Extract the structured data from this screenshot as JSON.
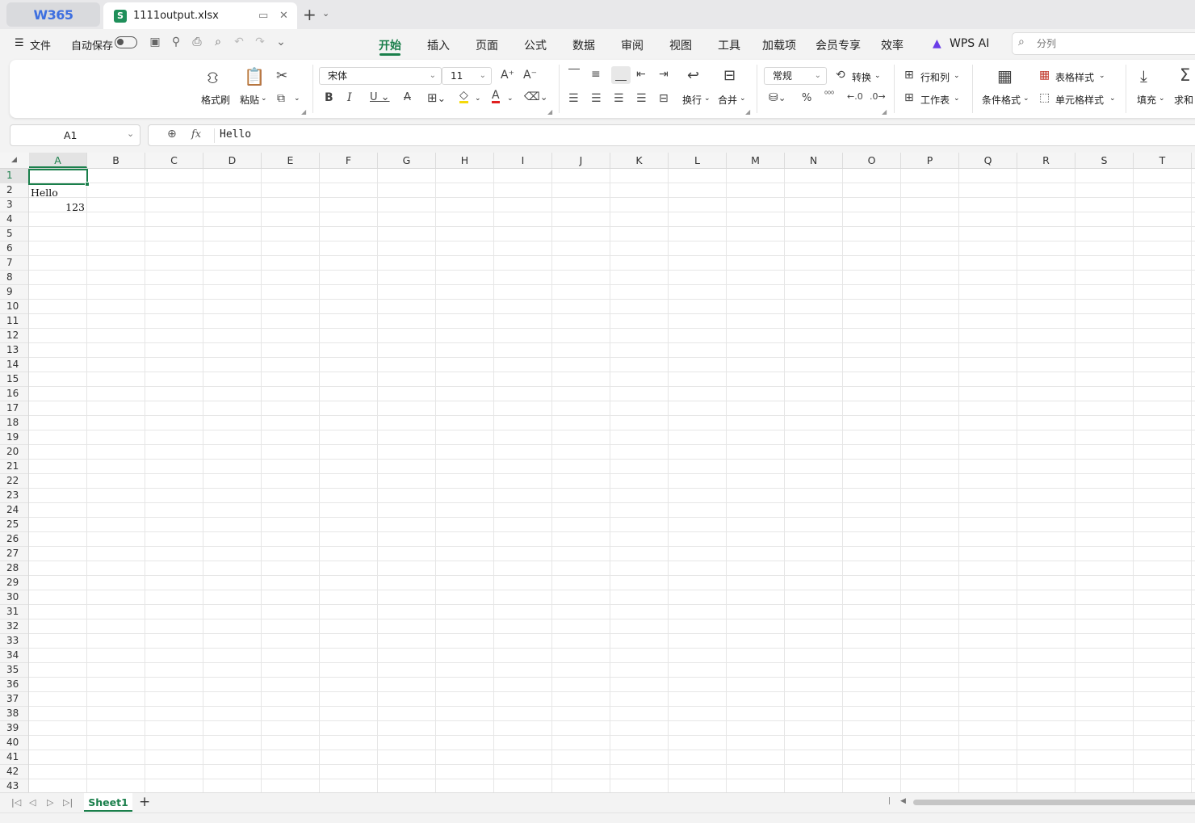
{
  "tabs": {
    "app_logo": "W365",
    "file_badge": "S",
    "file_title": "1111output.xlsx"
  },
  "menu": {
    "file_label": "文件",
    "autosave_label": "自动保存",
    "ribbon_tabs": [
      "开始",
      "插入",
      "页面",
      "公式",
      "数据",
      "审阅",
      "视图",
      "工具",
      "加载项",
      "会员专享",
      "效率"
    ],
    "active_tab": "开始",
    "wps_ai": "WPS AI",
    "search_placeholder": "分列"
  },
  "ribbon": {
    "format_painter": "格式刷",
    "paste": "粘贴",
    "font_name": "宋体",
    "font_size": "11",
    "wrap": "换行",
    "merge": "合并",
    "number_format": "常规",
    "convert": "转换",
    "rows_cols": "行和列",
    "worksheet": "工作表",
    "conditional_format": "条件格式",
    "table_style": "表格样式",
    "cell_style": "单元格样式",
    "fill": "填充",
    "sum": "求和"
  },
  "formula_bar": {
    "name_box": "A1",
    "fx_label": "fx",
    "content": "Hello"
  },
  "grid": {
    "columns": [
      "A",
      "B",
      "C",
      "D",
      "E",
      "F",
      "G",
      "H",
      "I",
      "J",
      "K",
      "L",
      "M",
      "N",
      "O",
      "P",
      "Q",
      "R",
      "S",
      "T"
    ],
    "selected_column": "A",
    "selected_row": 1,
    "row_count": 43,
    "cells": {
      "A1": "Hello",
      "A2": "123"
    }
  },
  "sheets": {
    "names": [
      "Sheet1"
    ],
    "active": "Sheet1"
  }
}
